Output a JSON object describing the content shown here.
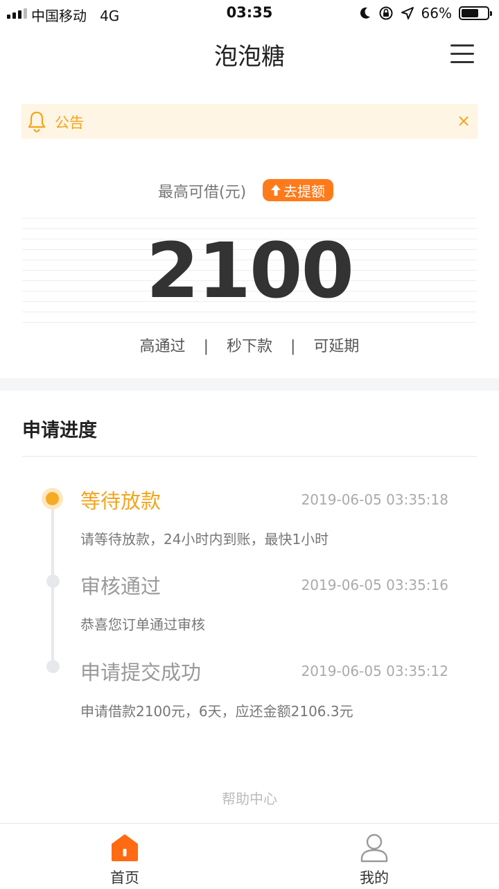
{
  "status_bar": {
    "carrier": "中国移动",
    "network": "4G",
    "time": "03:35",
    "battery": "66%",
    "battery_level": 0.66
  },
  "nav": {
    "title": "泡泡糖"
  },
  "notice": {
    "label": "公告",
    "close": "×"
  },
  "loan": {
    "limit_label": "最高可借(元)",
    "raise_label": "去提额",
    "amount": "2100",
    "features": [
      "高通过",
      "秒下款",
      "可延期"
    ],
    "separator": "|"
  },
  "progress": {
    "title": "申请进度",
    "steps": [
      {
        "title": "等待放款",
        "time": "2019-06-05 03:35:18",
        "desc": "请等待放款，24小时内到账，最快1小时"
      },
      {
        "title": "审核通过",
        "time": "2019-06-05 03:35:16",
        "desc": "恭喜您订单通过审核"
      },
      {
        "title": "申请提交成功",
        "time": "2019-06-05 03:35:12",
        "desc": "申请借款2100元，6天，应还金额2106.3元"
      }
    ]
  },
  "help_center": "帮助中心",
  "tabbar": {
    "home": "首页",
    "mine": "我的"
  },
  "colors": {
    "accent": "#f3a51d",
    "raise": "#ff7a1a",
    "tab_active": "#ff6a13",
    "notice_bg": "#fff5e4"
  }
}
